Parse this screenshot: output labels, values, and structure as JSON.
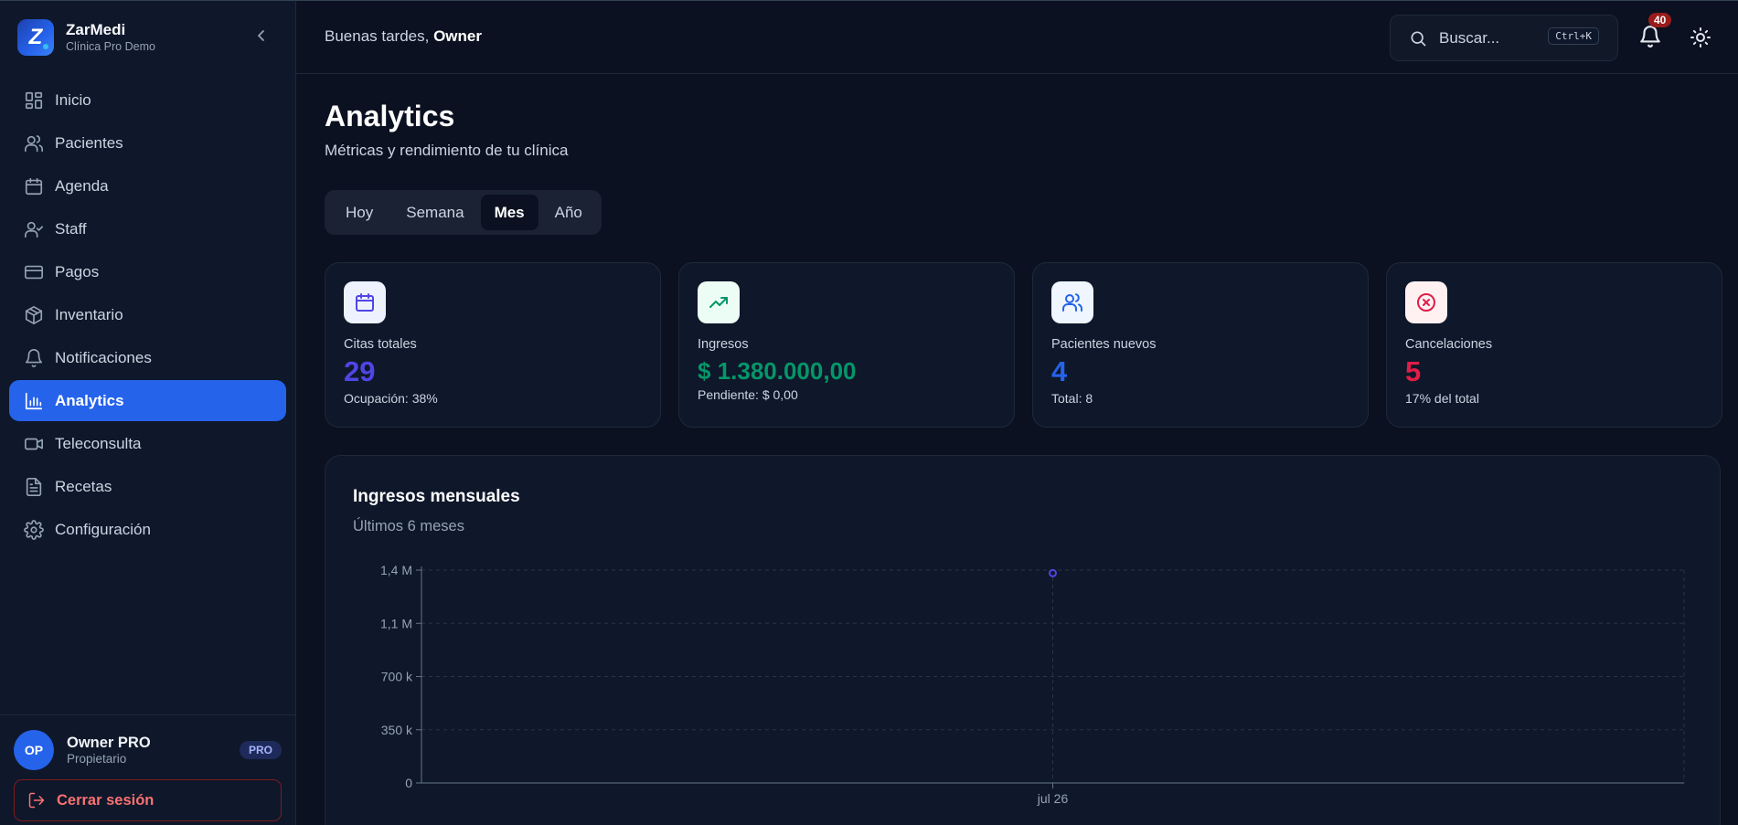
{
  "app": {
    "name": "ZarMedi",
    "subtitle": "Clínica Pro Demo",
    "logo_letter": "Z"
  },
  "sidebar": {
    "items": [
      {
        "label": "Inicio",
        "icon": "grid-icon",
        "active": false
      },
      {
        "label": "Pacientes",
        "icon": "users-icon",
        "active": false
      },
      {
        "label": "Agenda",
        "icon": "calendar-icon",
        "active": false
      },
      {
        "label": "Staff",
        "icon": "user-check-icon",
        "active": false
      },
      {
        "label": "Pagos",
        "icon": "credit-card-icon",
        "active": false
      },
      {
        "label": "Inventario",
        "icon": "package-icon",
        "active": false
      },
      {
        "label": "Notificaciones",
        "icon": "bell-icon",
        "active": false
      },
      {
        "label": "Analytics",
        "icon": "bar-chart-icon",
        "active": true
      },
      {
        "label": "Teleconsulta",
        "icon": "video-icon",
        "active": false
      },
      {
        "label": "Recetas",
        "icon": "file-text-icon",
        "active": false
      },
      {
        "label": "Configuración",
        "icon": "gear-icon",
        "active": false
      }
    ],
    "user": {
      "initials": "OP",
      "name": "Owner PRO",
      "role": "Propietario",
      "badge": "PRO"
    },
    "logout_label": "Cerrar sesión"
  },
  "header": {
    "greeting_prefix": "Buenas tardes, ",
    "greeting_name": "Owner",
    "search_placeholder": "Buscar...",
    "search_shortcut": "Ctrl+K",
    "notification_count": "40"
  },
  "page": {
    "title": "Analytics",
    "subtitle": "Métricas y rendimiento de tu clínica",
    "period_tabs": [
      {
        "label": "Hoy",
        "active": false
      },
      {
        "label": "Semana",
        "active": false
      },
      {
        "label": "Mes",
        "active": true
      },
      {
        "label": "Año",
        "active": false
      }
    ]
  },
  "stats": [
    {
      "label": "Citas totales",
      "value": "29",
      "sub": "Ocupación: 38%",
      "icon": "calendar-icon",
      "color": "#4f46e5",
      "icon_bg": "#eef2ff"
    },
    {
      "label": "Ingresos",
      "value": "$ 1.380.000,00",
      "sub": "Pendiente: $ 0,00",
      "icon": "trending-up-icon",
      "color": "#059669",
      "icon_bg": "#ecfdf5"
    },
    {
      "label": "Pacientes nuevos",
      "value": "4",
      "sub": "Total: 8",
      "icon": "users-icon",
      "color": "#2563eb",
      "icon_bg": "#eff6ff"
    },
    {
      "label": "Cancelaciones",
      "value": "5",
      "sub": "17% del total",
      "icon": "x-circle-icon",
      "color": "#e11d48",
      "icon_bg": "#fff1f2"
    }
  ],
  "revenue_chart": {
    "title": "Ingresos mensuales",
    "subtitle": "Últimos 6 meses"
  },
  "chart_data": {
    "type": "line",
    "title": "Ingresos mensuales",
    "subtitle": "Últimos 6 meses",
    "x": [
      "jul 26"
    ],
    "series": [
      {
        "values": [
          1380000
        ]
      }
    ],
    "ylim": [
      0,
      1400000
    ],
    "yticks": [
      0,
      350000,
      700000,
      1050000,
      1400000
    ],
    "ytick_labels": [
      "0",
      "350 k",
      "700 k",
      "1,1 M",
      "1,4 M"
    ],
    "xtick_labels": [
      "jul 26"
    ],
    "grid": true,
    "line_color": "#4f46e5"
  }
}
